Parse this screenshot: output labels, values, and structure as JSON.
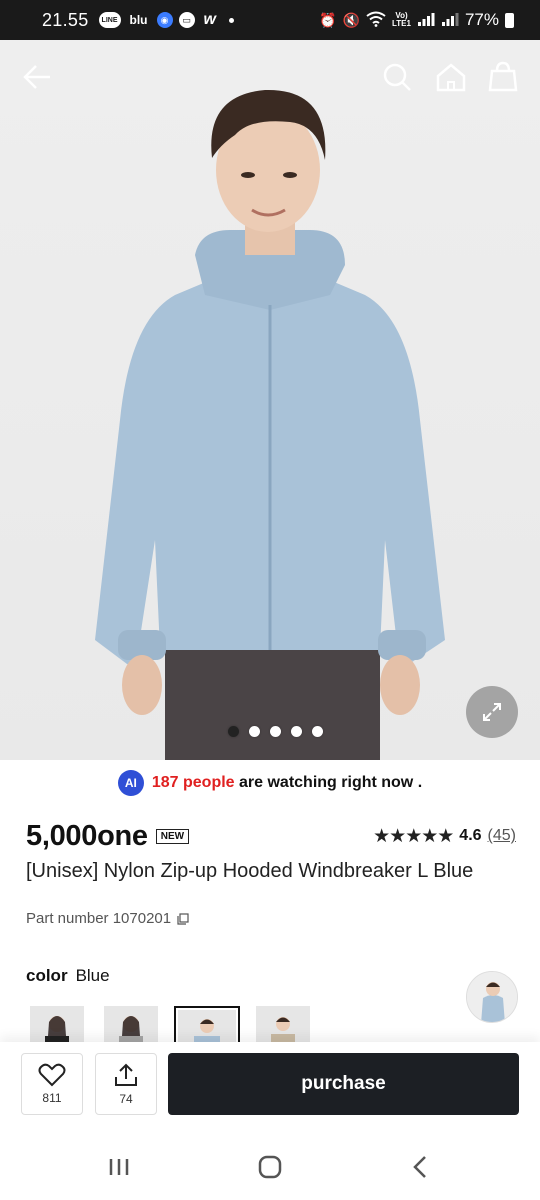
{
  "status_bar": {
    "time": "21.55",
    "apps": [
      "LINE",
      "blu",
      "",
      "",
      "w"
    ],
    "battery": "77%"
  },
  "header": {
    "icons": [
      "back-arrow-icon",
      "search-icon",
      "home-icon",
      "shopping-bag-icon"
    ]
  },
  "gallery": {
    "slide_count": 5,
    "active_slide": 1
  },
  "watching": {
    "ai_label": "AI",
    "count_text": "187 people",
    "suffix": "are watching right now ."
  },
  "product": {
    "price": "5,000one",
    "badge": "NEW",
    "rating": 4.6,
    "rating_value": "4.6",
    "rating_count": "(45)",
    "name": "[Unisex] Nylon Zip-up Hooded Windbreaker L Blue",
    "part_number": "Part number 1070201"
  },
  "color": {
    "label": "color",
    "value": "Blue",
    "options": [
      "black",
      "gray",
      "blue",
      "beige"
    ],
    "selected_index": 2
  },
  "actions": {
    "like_count": "811",
    "share_count": "74",
    "purchase_label": "purchase"
  },
  "colors": {
    "jacket": "#a9c2d8",
    "purchase_bg": "#1c1f24",
    "watch_red": "#e02020",
    "ai_blue": "#2f4fd6"
  }
}
